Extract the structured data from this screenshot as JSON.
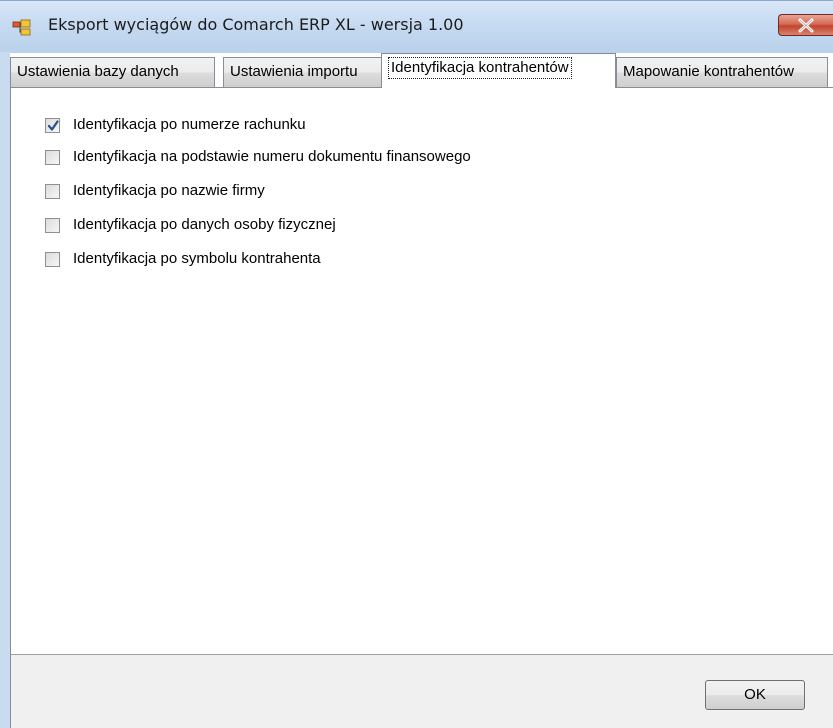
{
  "window": {
    "title": "Eksport wyciągów do Comarch ERP XL - wersja 1.00",
    "icon": "app-icon",
    "close_icon": "close-icon"
  },
  "tabs": [
    {
      "label": "Ustawienia bazy danych",
      "active": false
    },
    {
      "label": "Ustawienia importu",
      "active": false
    },
    {
      "label": "Identyfikacja kontrahentów",
      "active": true
    },
    {
      "label": "Mapowanie kontrahentów",
      "active": false
    }
  ],
  "options": [
    {
      "label": "Identyfikacja po numerze rachunku",
      "checked": true
    },
    {
      "label": "Identyfikacja na podstawie numeru dokumentu finansowego",
      "checked": false
    },
    {
      "label": "Identyfikacja po nazwie firmy",
      "checked": false
    },
    {
      "label": "Identyfikacja po danych osoby fizycznej",
      "checked": false
    },
    {
      "label": "Identyfikacja po symbolu kontrahenta",
      "checked": false
    }
  ],
  "footer": {
    "ok_label": "OK"
  },
  "colors": {
    "titlebar": "#c6daf1",
    "close_button": "#c2452d",
    "check_mark": "#2a4f8f"
  }
}
